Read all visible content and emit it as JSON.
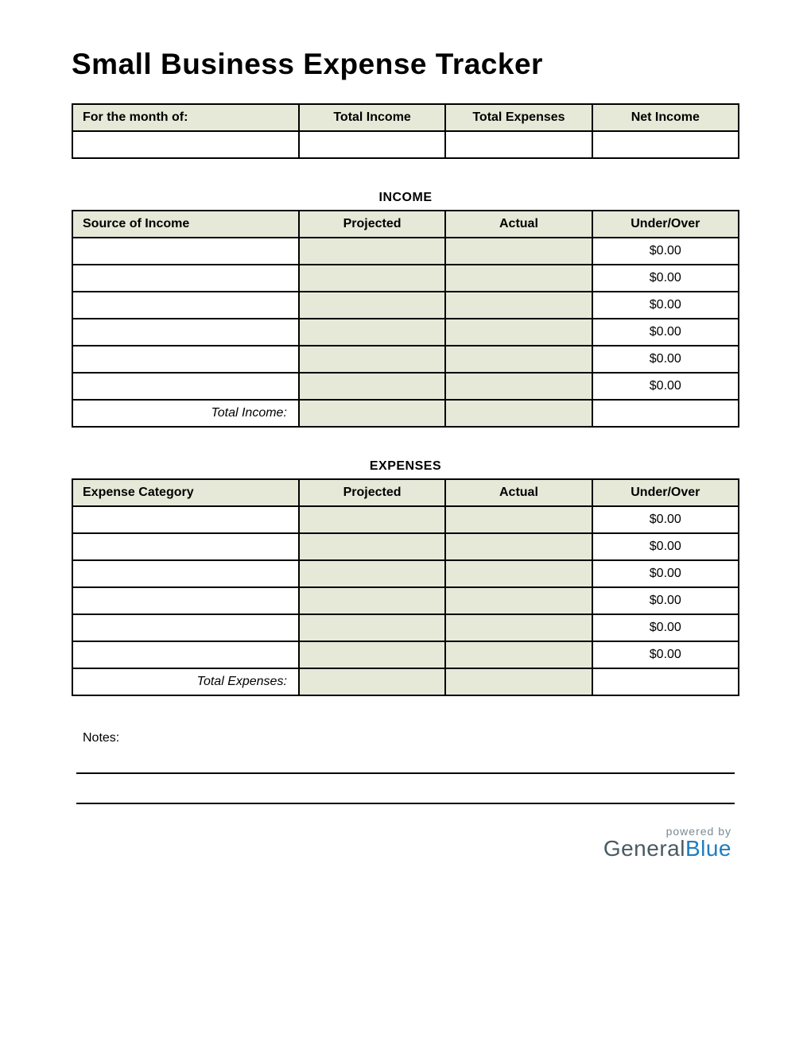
{
  "title": "Small Business Expense Tracker",
  "summary": {
    "headers": [
      "For the month of:",
      "Total Income",
      "Total Expenses",
      "Net Income"
    ],
    "values": [
      "",
      "",
      "",
      ""
    ]
  },
  "income": {
    "section_title": "INCOME",
    "headers": [
      "Source of Income",
      "Projected",
      "Actual",
      "Under/Over"
    ],
    "rows": [
      {
        "source": "",
        "projected": "",
        "actual": "",
        "over": "$0.00"
      },
      {
        "source": "",
        "projected": "",
        "actual": "",
        "over": "$0.00"
      },
      {
        "source": "",
        "projected": "",
        "actual": "",
        "over": "$0.00"
      },
      {
        "source": "",
        "projected": "",
        "actual": "",
        "over": "$0.00"
      },
      {
        "source": "",
        "projected": "",
        "actual": "",
        "over": "$0.00"
      },
      {
        "source": "",
        "projected": "",
        "actual": "",
        "over": "$0.00"
      }
    ],
    "total_label": "Total Income:",
    "totals": {
      "projected": "",
      "actual": "",
      "over": ""
    }
  },
  "expenses": {
    "section_title": "EXPENSES",
    "headers": [
      "Expense Category",
      "Projected",
      "Actual",
      "Under/Over"
    ],
    "rows": [
      {
        "cat": "",
        "projected": "",
        "actual": "",
        "over": "$0.00"
      },
      {
        "cat": "",
        "projected": "",
        "actual": "",
        "over": "$0.00"
      },
      {
        "cat": "",
        "projected": "",
        "actual": "",
        "over": "$0.00"
      },
      {
        "cat": "",
        "projected": "",
        "actual": "",
        "over": "$0.00"
      },
      {
        "cat": "",
        "projected": "",
        "actual": "",
        "over": "$0.00"
      },
      {
        "cat": "",
        "projected": "",
        "actual": "",
        "over": "$0.00"
      }
    ],
    "total_label": "Total Expenses:",
    "totals": {
      "projected": "",
      "actual": "",
      "over": ""
    }
  },
  "notes_label": "Notes:",
  "footer": {
    "powered": "powered by",
    "brand_a": "General",
    "brand_b": "Blue"
  }
}
